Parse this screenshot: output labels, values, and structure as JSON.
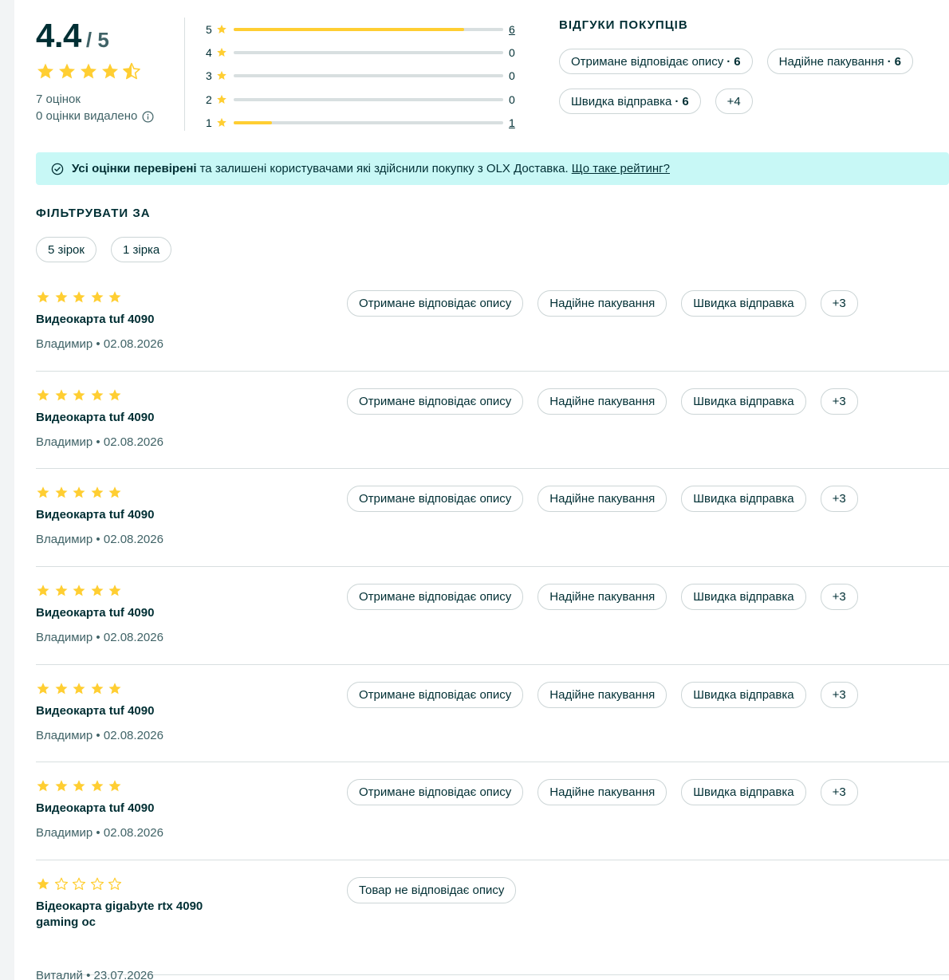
{
  "colors": {
    "star": "#ffce32",
    "star_empty": "#d8dfe0",
    "text": "#002f34",
    "muted": "#406367",
    "banner_bg": "#c8f8f6",
    "border": "#ccd5d6"
  },
  "summary": {
    "score": "4.4",
    "score_max": "/ 5",
    "score_value": 4.4,
    "count_text": "7 оцінок",
    "removed_text": "0 оцінки видалено"
  },
  "distribution": [
    {
      "stars": "5",
      "count": "6",
      "fraction": 0.855,
      "link": true
    },
    {
      "stars": "4",
      "count": "0",
      "fraction": 0,
      "link": false
    },
    {
      "stars": "3",
      "count": "0",
      "fraction": 0,
      "link": false
    },
    {
      "stars": "2",
      "count": "0",
      "fraction": 0,
      "link": false
    },
    {
      "stars": "1",
      "count": "1",
      "fraction": 0.143,
      "link": true
    }
  ],
  "buyers": {
    "title": "ВІДГУКИ ПОКУПЦІВ",
    "tags": [
      {
        "label": "Отримане відповідає опису",
        "count": "6"
      },
      {
        "label": "Надійне пакування",
        "count": "6"
      },
      {
        "label": "Швидка відправка",
        "count": "6"
      },
      {
        "label": "+4",
        "count": ""
      }
    ]
  },
  "banner": {
    "bold": "Усі оцінки перевірені",
    "text": "та залишені користувачами які здійснили покупку з OLX Доставка.",
    "link": "Що таке рейтинг?"
  },
  "filters": {
    "title": "ФІЛЬТРУВАТИ ЗА",
    "chips": [
      "5 зірок",
      "1 зірка"
    ]
  },
  "reviews": [
    {
      "rating": 5,
      "title": "Видеокарта tuf 4090",
      "author": "Владимир",
      "date": "02.08.2026",
      "tags": [
        "Отримане відповідає опису",
        "Надійне пакування",
        "Швидка відправка",
        "+3"
      ]
    },
    {
      "rating": 5,
      "title": "Видеокарта tuf 4090",
      "author": "Владимир",
      "date": "02.08.2026",
      "tags": [
        "Отримане відповідає опису",
        "Надійне пакування",
        "Швидка відправка",
        "+3"
      ]
    },
    {
      "rating": 5,
      "title": "Видеокарта tuf 4090",
      "author": "Владимир",
      "date": "02.08.2026",
      "tags": [
        "Отримане відповідає опису",
        "Надійне пакування",
        "Швидка відправка",
        "+3"
      ]
    },
    {
      "rating": 5,
      "title": "Видеокарта tuf 4090",
      "author": "Владимир",
      "date": "02.08.2026",
      "tags": [
        "Отримане відповідає опису",
        "Надійне пакування",
        "Швидка відправка",
        "+3"
      ]
    },
    {
      "rating": 5,
      "title": "Видеокарта tuf 4090",
      "author": "Владимир",
      "date": "02.08.2026",
      "tags": [
        "Отримане відповідає опису",
        "Надійне пакування",
        "Швидка відправка",
        "+3"
      ]
    },
    {
      "rating": 5,
      "title": "Видеокарта tuf 4090",
      "author": "Владимир",
      "date": "02.08.2026",
      "tags": [
        "Отримане відповідає опису",
        "Надійне пакування",
        "Швидка відправка",
        "+3"
      ]
    },
    {
      "rating": 1,
      "title": "Відеокарта gigabyte rtx 4090 gaming oc",
      "author": "Виталий",
      "date": "23.07.2026",
      "tags": [
        "Товар не відповідає опису"
      ]
    }
  ]
}
